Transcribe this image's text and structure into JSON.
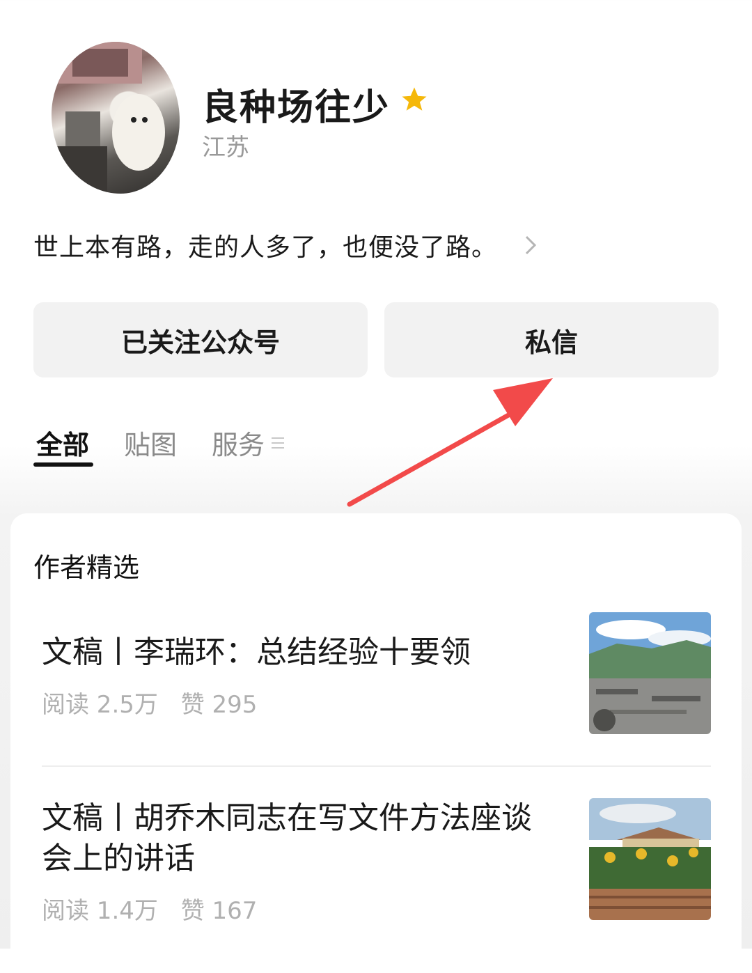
{
  "profile": {
    "name": "良种场往少",
    "region": "江苏",
    "bio": "世上本有路，走的人多了，也便没了路。"
  },
  "buttons": {
    "follow_label": "已关注公众号",
    "message_label": "私信"
  },
  "tabs": [
    {
      "label": "全部",
      "active": true
    },
    {
      "label": "贴图",
      "active": false
    },
    {
      "label": "服务",
      "active": false
    }
  ],
  "section": {
    "title": "作者精选"
  },
  "articles": [
    {
      "title": "文稿丨李瑞环：总结经验十要领",
      "reads": "阅读 2.5万",
      "likes": "赞 295",
      "thumb": "mountain-town-photo"
    },
    {
      "title": "文稿丨胡乔木同志在写文件方法座谈\n会上的讲话",
      "reads": "阅读 1.4万",
      "likes": "赞 167",
      "thumb": "sunflower-field-photo"
    }
  ],
  "colors": {
    "star": "#f5b80a",
    "annotation_arrow": "#f24a4a",
    "meta_text": "#b0b0b0"
  },
  "icons": [
    "star-icon",
    "chevron-right-icon",
    "menu-lines-icon",
    "annotation-arrow-icon"
  ]
}
